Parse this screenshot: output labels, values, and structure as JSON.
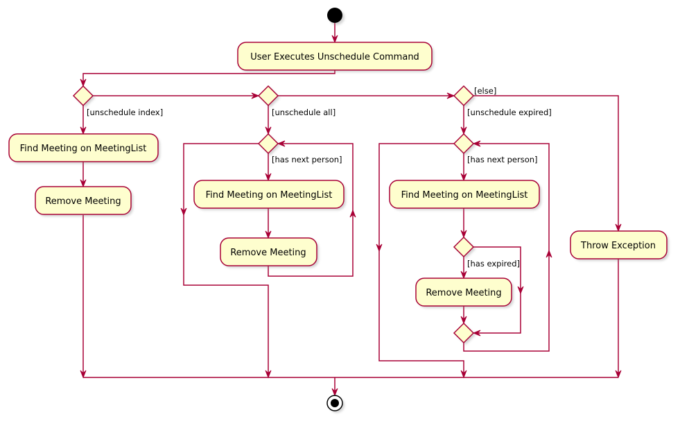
{
  "diagram": {
    "type": "uml-activity",
    "colors": {
      "line": "#A80036",
      "activity_fill": "#FEFECE",
      "node": "#000000"
    },
    "start": {
      "label": "start"
    },
    "end": {
      "label": "end"
    },
    "activities": {
      "execute": "User Executes Unschedule Command",
      "index_find": "Find Meeting on MeetingList",
      "index_remove": "Remove Meeting",
      "all_find": "Find Meeting on MeetingList",
      "all_remove": "Remove Meeting",
      "expired_find": "Find Meeting on MeetingList",
      "expired_remove": "Remove Meeting",
      "throw": "Throw Exception"
    },
    "guards": {
      "unschedule_index": "[unschedule index]",
      "unschedule_all": "[unschedule all]",
      "unschedule_expired": "[unschedule expired]",
      "else": "[else]",
      "all_has_next": "[has next person]",
      "expired_has_next": "[has next person]",
      "has_expired": "[has expired]"
    }
  }
}
